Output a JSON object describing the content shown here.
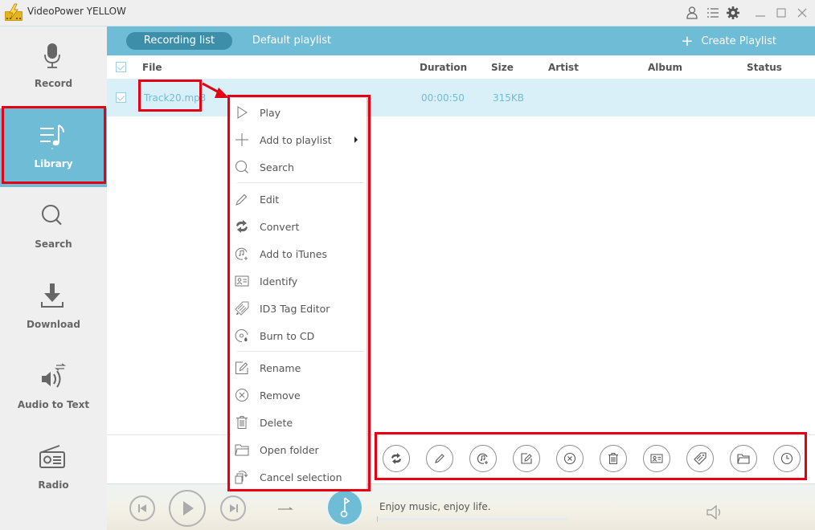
{
  "app": {
    "title": "VideoPower YELLOW",
    "window_controls": [
      "user-icon",
      "menu-list-icon",
      "gear-icon",
      "minimize-icon",
      "maximize-icon",
      "close-icon"
    ]
  },
  "sidebar": {
    "items": [
      {
        "label": "Record",
        "icon": "microphone-icon",
        "active": false
      },
      {
        "label": "Library",
        "icon": "music-list-icon",
        "active": true
      },
      {
        "label": "Search",
        "icon": "search-icon",
        "active": false
      },
      {
        "label": "Download",
        "icon": "download-icon",
        "active": false
      },
      {
        "label": "Audio to Text",
        "icon": "speaker-convert-icon",
        "active": false
      },
      {
        "label": "Radio",
        "icon": "radio-icon",
        "active": false
      }
    ]
  },
  "tabs": {
    "items": [
      {
        "label": "Recording list",
        "active": true
      },
      {
        "label": "Default playlist",
        "active": false
      }
    ],
    "create_playlist": "Create Playlist"
  },
  "table": {
    "columns": [
      "File",
      "Duration",
      "Size",
      "Artist",
      "Album",
      "Status"
    ],
    "rows": [
      {
        "checked": true,
        "file": "Track20.mp3",
        "duration": "00:00:50",
        "size": "315KB",
        "artist": "",
        "album": "",
        "status": ""
      }
    ]
  },
  "context_menu": {
    "items": [
      {
        "label": "Play",
        "icon": "play-icon"
      },
      {
        "label": "Add to playlist",
        "icon": "plus-icon",
        "submenu": true
      },
      {
        "label": "Search",
        "icon": "search-icon"
      },
      {
        "label": "Edit",
        "icon": "pencil-icon"
      },
      {
        "label": "Convert",
        "icon": "convert-icon"
      },
      {
        "label": "Add to iTunes",
        "icon": "itunes-icon"
      },
      {
        "label": "Identify",
        "icon": "id-card-icon"
      },
      {
        "label": "ID3 Tag Editor",
        "icon": "tag-edit-icon"
      },
      {
        "label": "Burn to CD",
        "icon": "burn-cd-icon"
      },
      {
        "label": "Rename",
        "icon": "rename-icon"
      },
      {
        "label": "Remove",
        "icon": "remove-icon"
      },
      {
        "label": "Delete",
        "icon": "trash-icon"
      },
      {
        "label": "Open folder",
        "icon": "folder-icon"
      },
      {
        "label": "Cancel selection",
        "icon": "cancel-selection-icon"
      }
    ]
  },
  "action_toolbar": {
    "buttons": [
      "convert",
      "edit",
      "add-to-itunes",
      "rename",
      "remove",
      "delete",
      "identify",
      "id3-tag-editor",
      "open-folder",
      "schedule"
    ]
  },
  "player": {
    "tagline": "Enjoy music, enjoy life.",
    "progress": 0
  },
  "colors": {
    "accent": "#6fbcd6",
    "accent_dark": "#3d8ea8",
    "selected_row": "#d9f0f8",
    "annotation_red": "#e60012"
  }
}
